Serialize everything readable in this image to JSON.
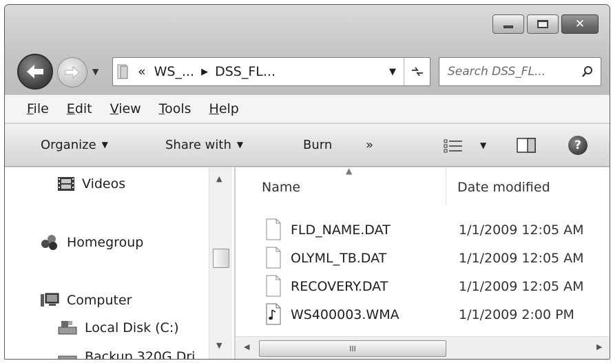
{
  "address": {
    "overflow": "«",
    "segments": [
      "WS_...",
      "DSS_FL..."
    ],
    "separator": "▶"
  },
  "search": {
    "placeholder": "Search DSS_FL..."
  },
  "menu": [
    "File",
    "Edit",
    "View",
    "Tools",
    "Help"
  ],
  "toolbar": {
    "organize": "Organize",
    "share_with": "Share with",
    "burn": "Burn",
    "more": "»"
  },
  "nav_tree": [
    {
      "label": "Videos",
      "icon": "film-icon"
    },
    {
      "label": "Homegroup",
      "icon": "homegroup-icon"
    },
    {
      "label": "Computer",
      "icon": "computer-icon"
    },
    {
      "label": "Local Disk (C:)",
      "icon": "drive-icon"
    },
    {
      "label": "Backup 320G Dri",
      "icon": "drive-icon"
    }
  ],
  "columns": {
    "name": "Name",
    "date": "Date modified"
  },
  "files": [
    {
      "name": "FLD_NAME.DAT",
      "date": "1/1/2009 12:05 AM",
      "icon": "file-icon"
    },
    {
      "name": "OLYML_TB.DAT",
      "date": "1/1/2009 12:05 AM",
      "icon": "file-icon"
    },
    {
      "name": "RECOVERY.DAT",
      "date": "1/1/2009 12:05 AM",
      "icon": "file-icon"
    },
    {
      "name": "WS400003.WMA",
      "date": "1/1/2009 2:00 PM",
      "icon": "audio-file-icon"
    }
  ],
  "scroll_grip": "III"
}
